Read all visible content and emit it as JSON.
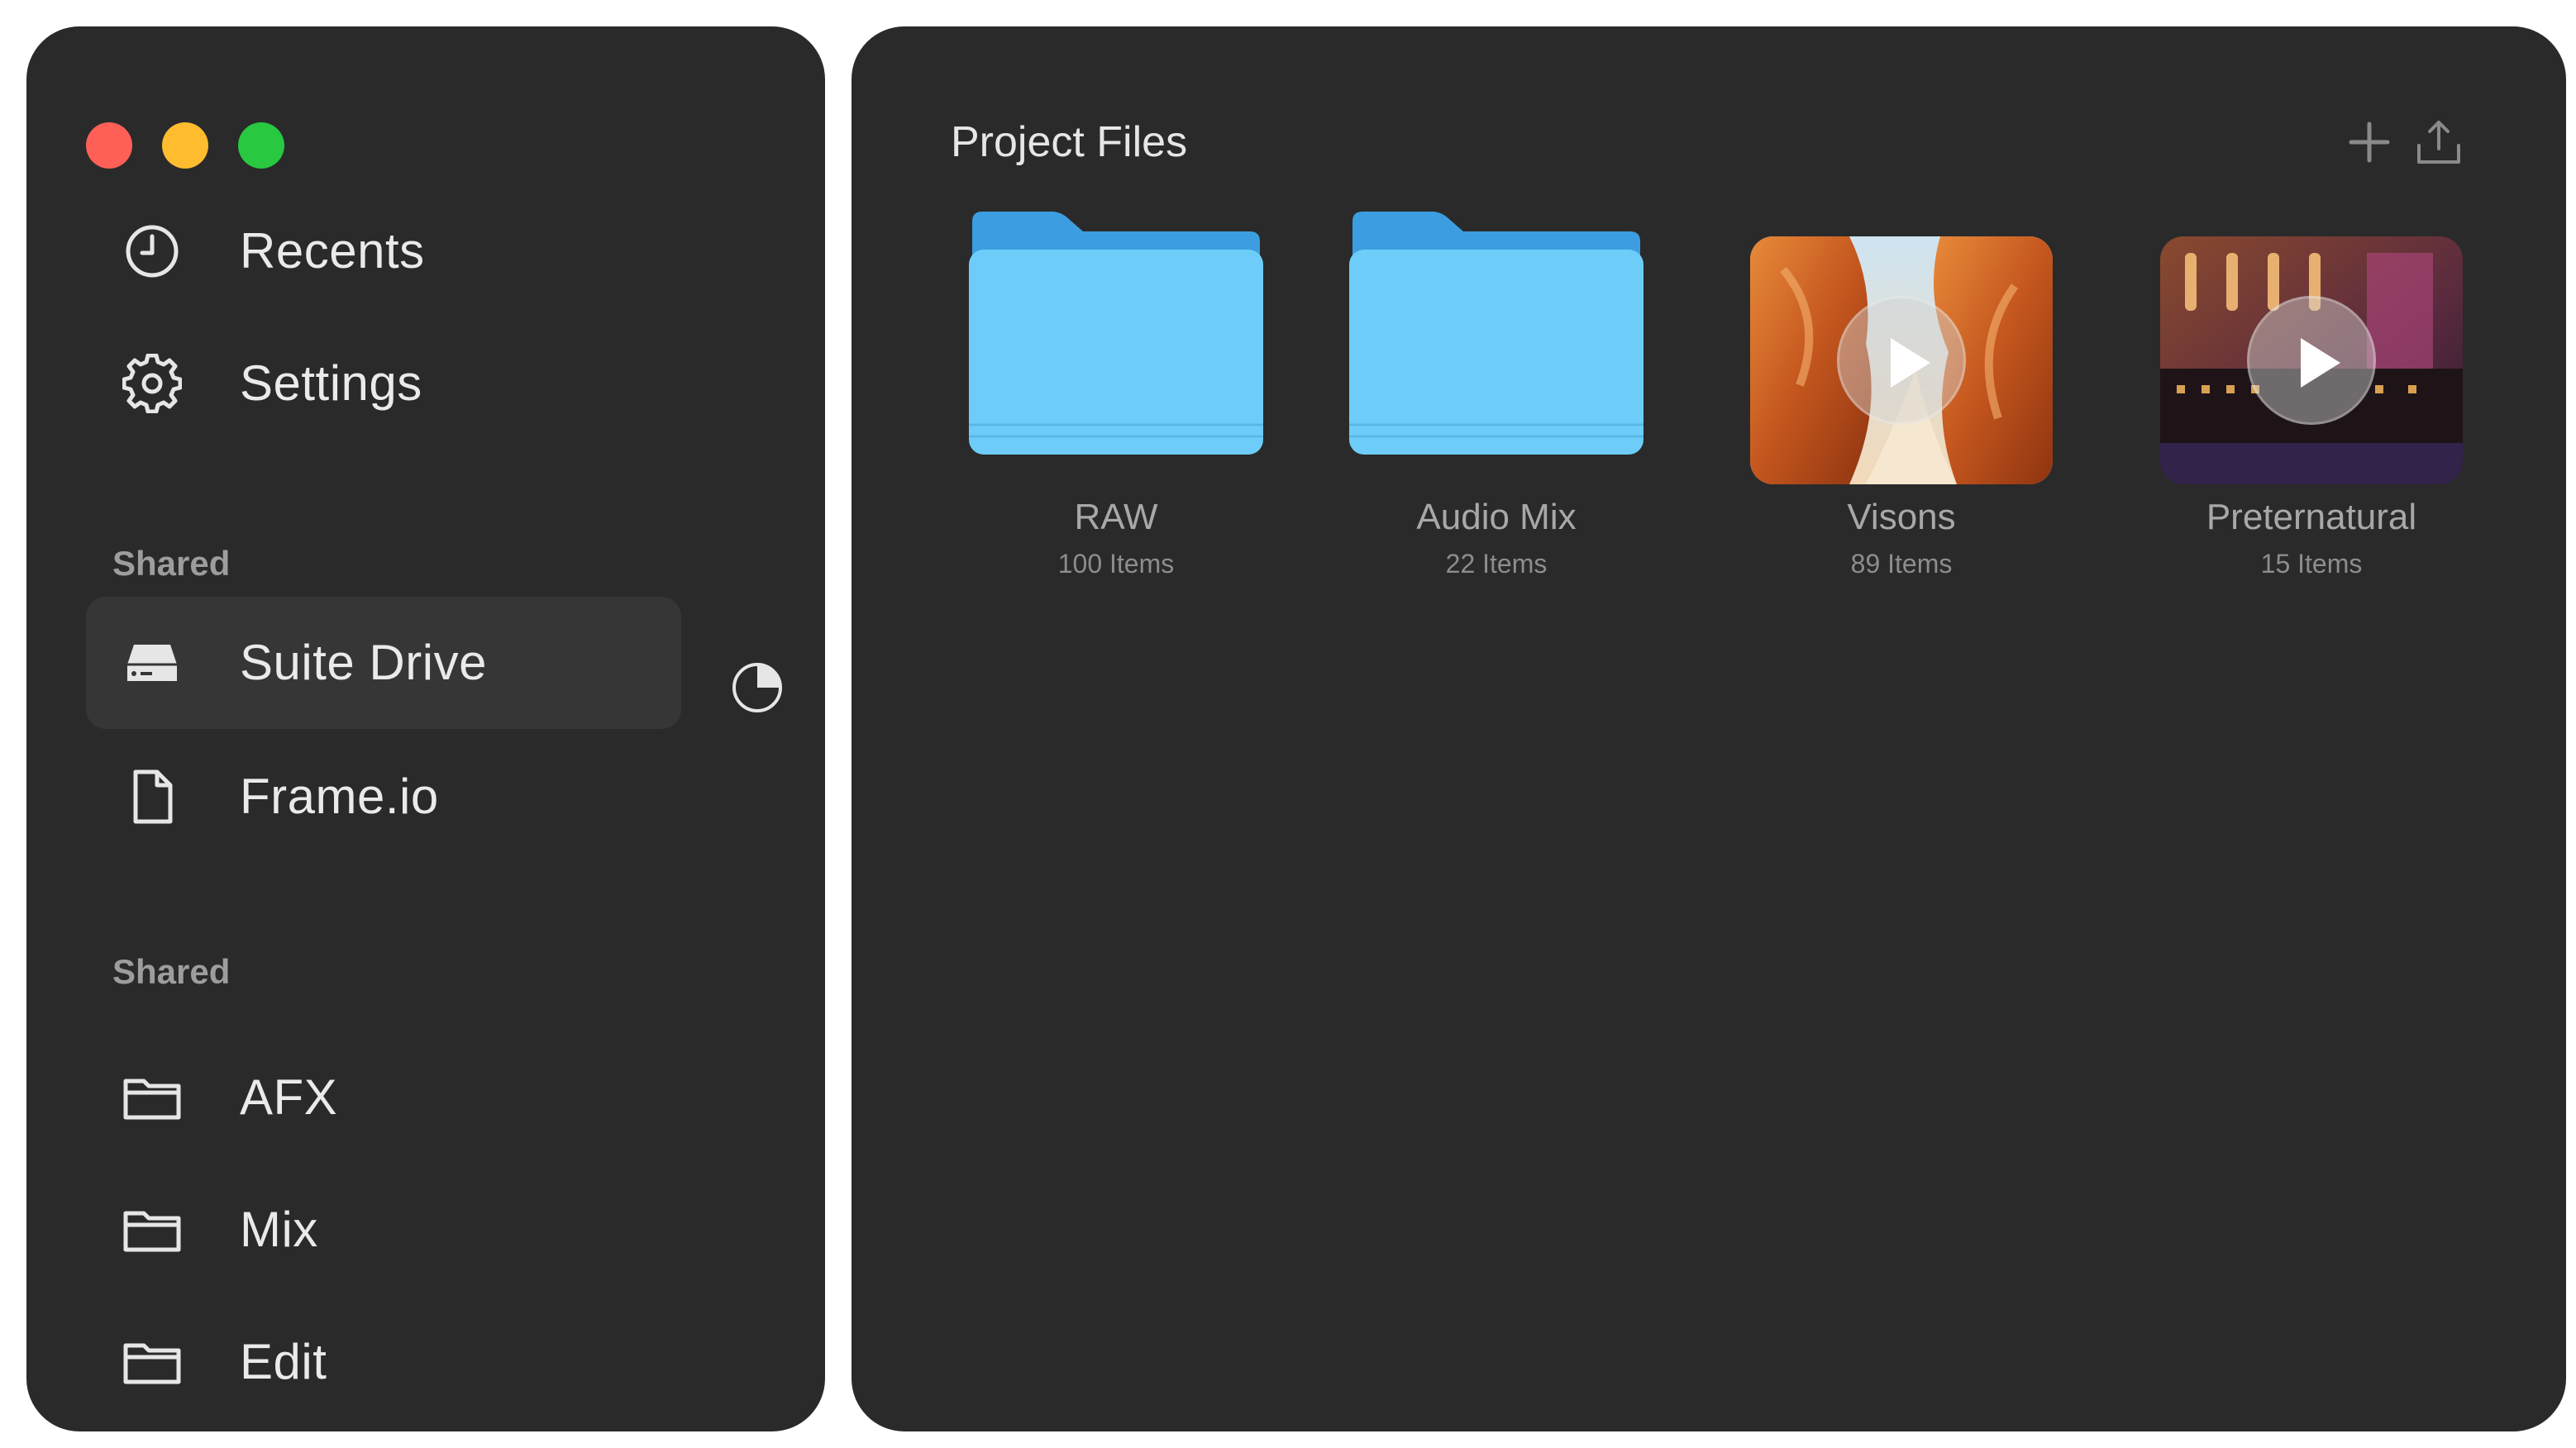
{
  "window": {
    "controls": [
      "close",
      "minimize",
      "zoom"
    ],
    "colors": {
      "close": "#fe5f57",
      "minimize": "#febc2e",
      "zoom": "#28c840"
    }
  },
  "sidebar": {
    "top_items": [
      {
        "label": "Recents",
        "icon": "clock-icon"
      },
      {
        "label": "Settings",
        "icon": "gear-icon"
      }
    ],
    "sections": [
      {
        "title": "Shared",
        "items": [
          {
            "label": "Suite Drive",
            "icon": "drive-icon",
            "selected": true
          },
          {
            "label": "Frame.io",
            "icon": "document-icon"
          }
        ]
      },
      {
        "title": "Shared",
        "items": [
          {
            "label": "AFX",
            "icon": "folder-icon"
          },
          {
            "label": "Mix",
            "icon": "folder-icon"
          },
          {
            "label": "Edit",
            "icon": "folder-icon"
          }
        ]
      }
    ],
    "usage_icon": "pie-chart-icon"
  },
  "main": {
    "title": "Project Files",
    "toolbar": {
      "add_icon": "plus-icon",
      "share_icon": "share-icon"
    },
    "items": [
      {
        "name": "RAW",
        "count": "100 Items",
        "kind": "folder"
      },
      {
        "name": "Audio Mix",
        "count": "22 Items",
        "kind": "folder"
      },
      {
        "name": "Visons",
        "count": "89 Items",
        "kind": "video"
      },
      {
        "name": "Preternatural",
        "count": "15 Items",
        "kind": "video"
      }
    ],
    "colors": {
      "accent_folder": "#6cc8f5",
      "background": "#2a2a2a"
    }
  }
}
